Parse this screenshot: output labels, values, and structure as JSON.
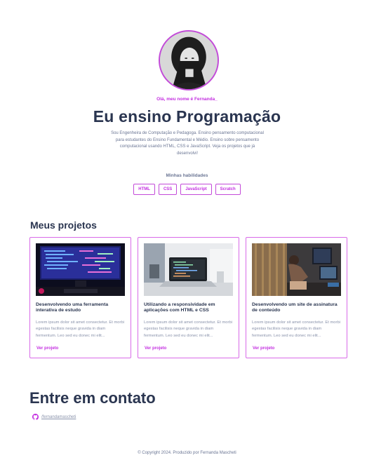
{
  "hero": {
    "greeting": "Olá, meu nome é Fernanda_",
    "title": "Eu ensino Programação",
    "bio": "Sou Engenheira de Computação e Pedagoga. Ensino pensamento computacional para estudantes do Ensino Fundamental e Médio. Ensino sobre pensamento computacional usando HTML, CSS e JavaScript. Veja os projetos que já desenvolvi!",
    "avatar_icon": "profile-photo"
  },
  "skills": {
    "label": "Minhas habilidades",
    "items": [
      "HTML",
      "CSS",
      "JavaScript",
      "Scratch"
    ]
  },
  "projects": {
    "title": "Meus projetos",
    "items": [
      {
        "title": "Desenvolvendo uma ferramenta interativa de estudo",
        "text": "Lorem ipsum dolor sit amet consectetur. Et morbi egestas facilisis neque gravida in diam fermentum. Leo sed eu donec mi elit...",
        "link": "Ver projeto",
        "image_icon": "code-monitor-image"
      },
      {
        "title": "Utilizando a responsividade em aplicações com HTML e CSS",
        "text": "Lorem ipsum dolor sit amet consectetur. Et morbi egestas facilisis neque gravida in diam fermentum. Leo sed eu donec mi elit...",
        "link": "Ver projeto",
        "image_icon": "laptop-desk-image"
      },
      {
        "title": "Desenvolvendo um site de assinatura de conteúdo",
        "text": "Lorem ipsum dolor sit amet consectetur. Et morbi egestas facilisis neque gravida in diam fermentum. Leo sed eu donec mi elit...",
        "link": "Ver projeto",
        "image_icon": "woman-at-computer-image"
      }
    ]
  },
  "contact": {
    "title": "Entre em contato",
    "github_handle": "/fernandamascheti",
    "github_icon": "github-icon"
  },
  "footer": {
    "text": "© Copyright 2024. Produzido por Fernanda Mascheti"
  },
  "colors": {
    "accent": "#c32ee0",
    "heading": "#2a3550",
    "muted": "#6b7694"
  }
}
